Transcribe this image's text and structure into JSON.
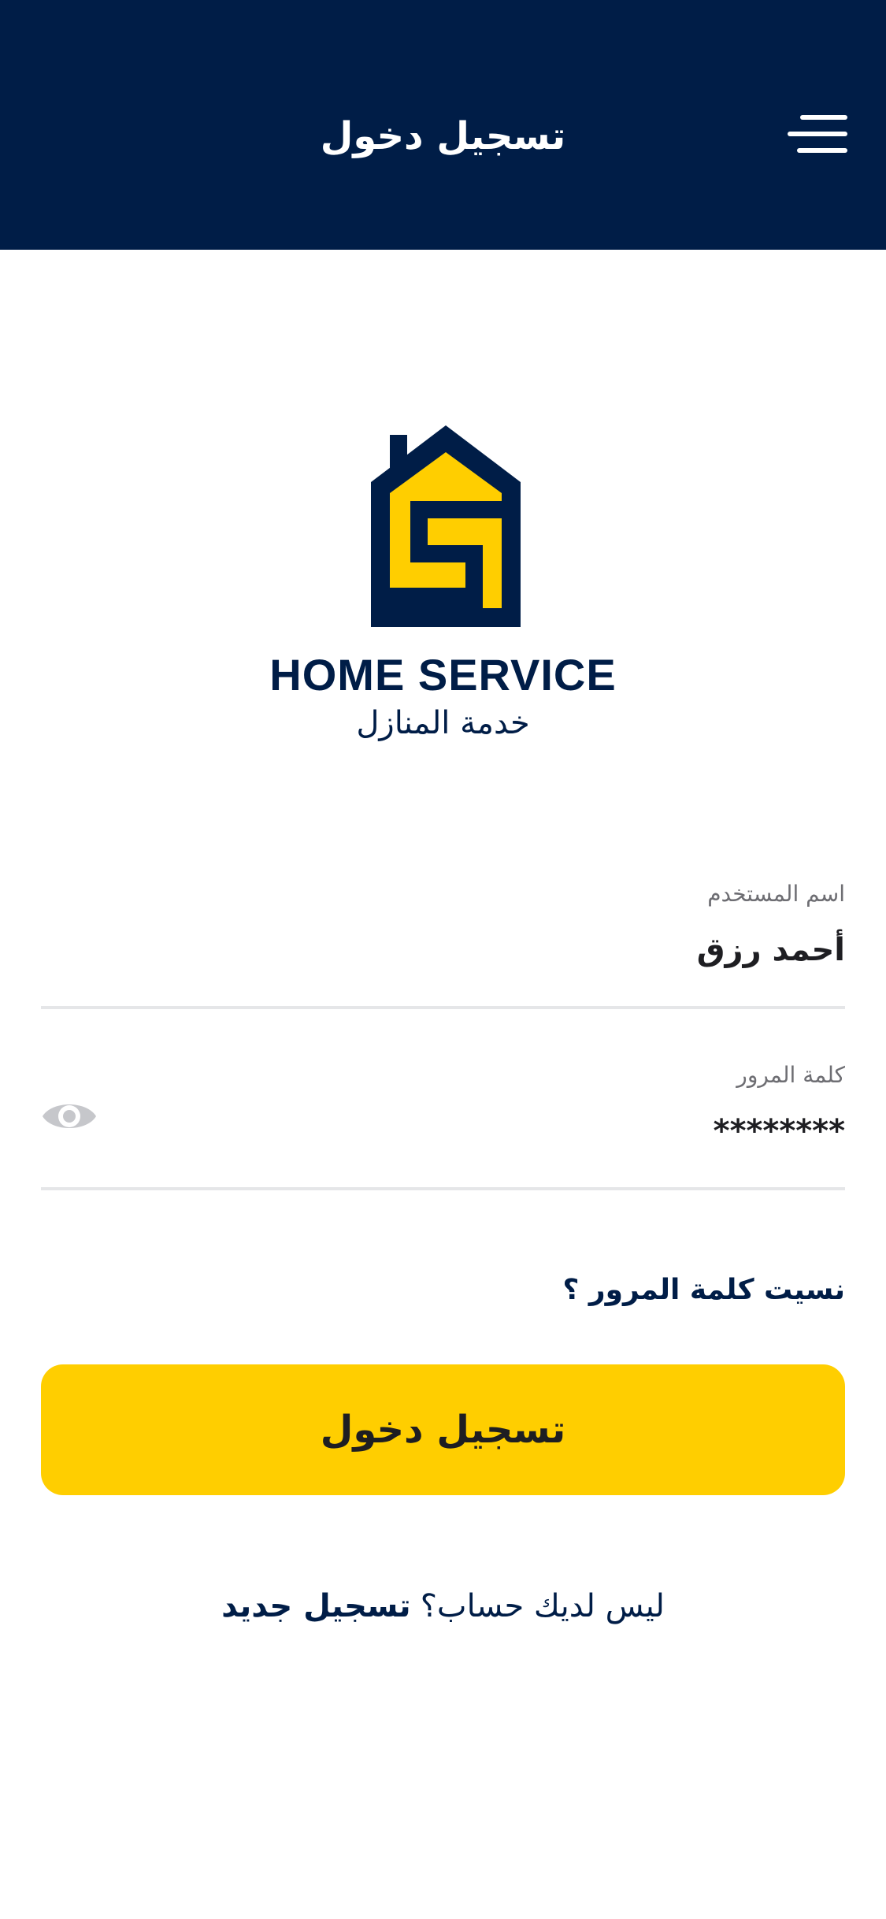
{
  "header": {
    "title": "تسجيل دخول",
    "menu_icon": "hamburger-menu-icon"
  },
  "brand": {
    "logo_icon": "home-service-house-logo",
    "name_en": "HOME SERVICE",
    "name_ar": "خدمة المنازل"
  },
  "form": {
    "username": {
      "label": "اسم المستخدم",
      "value": "أحمد رزق"
    },
    "password": {
      "label": "كلمة المرور",
      "value": "********",
      "toggle_icon": "eye-icon"
    },
    "forgot_password": "نسيت كلمة المرور ؟",
    "login_button": "تسجيل دخول"
  },
  "footer": {
    "question": "ليس لديك حساب؟",
    "register_link": "تسجيل جديد"
  },
  "colors": {
    "primary": "#001D47",
    "accent": "#FFCE00",
    "field_line": "#E5E6E8",
    "label": "#6E6E73"
  }
}
